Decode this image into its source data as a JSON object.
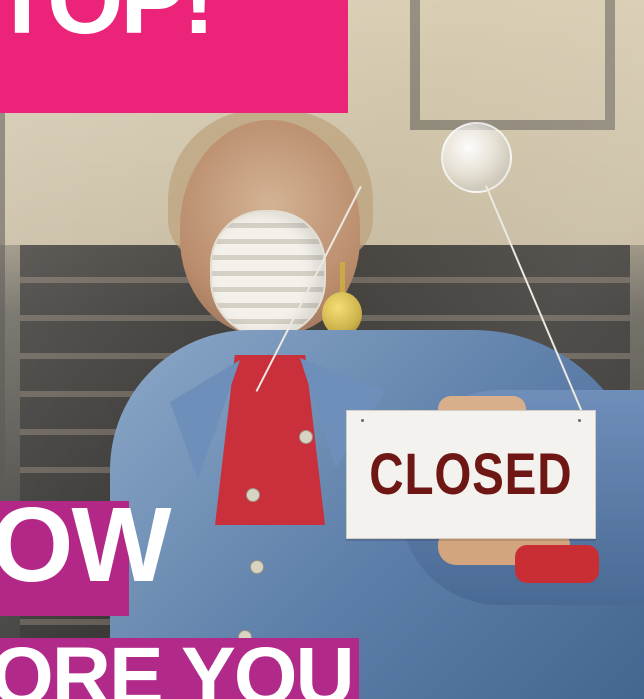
{
  "sign": {
    "text": "CLOSED"
  },
  "banners": {
    "top_text": "TOP!",
    "middle_text": "OW",
    "bottom_text": "ORE YOU"
  }
}
